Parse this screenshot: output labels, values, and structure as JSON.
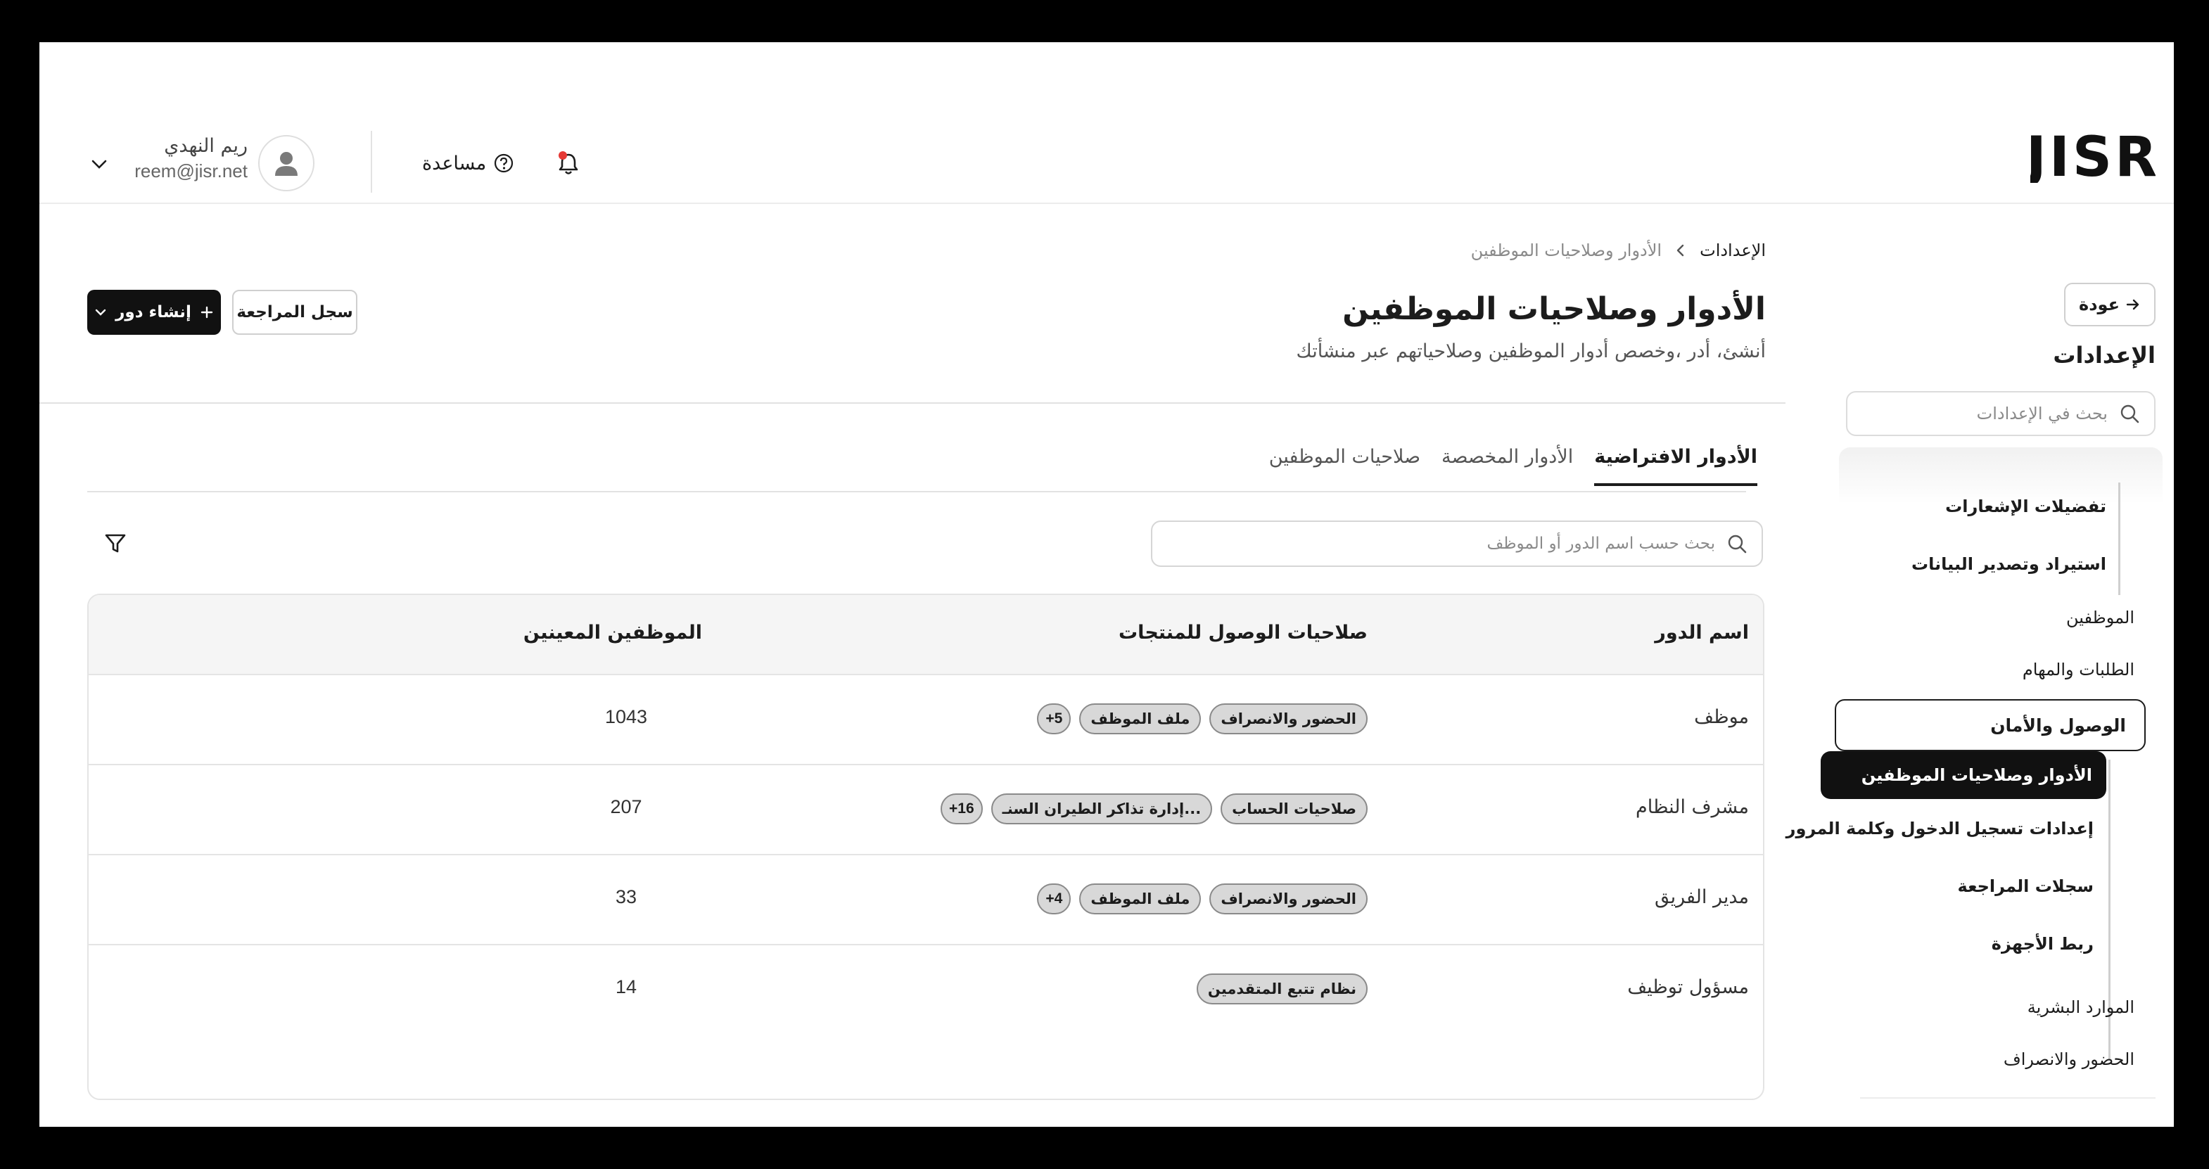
{
  "brand": {
    "logo_text": "JISR"
  },
  "header": {
    "help_label": "مساعدة",
    "user_name": "ريم النهدي",
    "user_email": "reem@jisr.net",
    "notification_dot_color": "#e53935"
  },
  "sidebar": {
    "back_label": "عودة",
    "title": "الإعدادات",
    "search_placeholder": "بحث في الإعدادات",
    "items": {
      "notif_prefs": "تفضيلات الإشعارات",
      "import_export": "استيراد وتصدير البيانات",
      "employees": "الموظفين",
      "requests_tasks": "الطلبات والمهام",
      "access_security": "الوصول والأمان",
      "roles_permissions": "الأدوار وصلاحيات الموظفين",
      "login_settings": "إعدادات تسجيل الدخول وكلمة المرور",
      "audit_logs": "سجلات المراجعة",
      "device_linking": "ربط الأجهزة",
      "hr": "الموارد البشرية",
      "attendance": "الحضور والانصراف"
    }
  },
  "breadcrumb": {
    "root": "الإعدادات",
    "current": "الأدوار وصلاحيات الموظفين"
  },
  "page": {
    "title": "الأدوار وصلاحيات الموظفين",
    "subtitle": "أنشئ، أدر ،وخصص أدوار الموظفين وصلاحياتهم عبر منشأتك",
    "create_label": "إنشاء دور",
    "audit_label": "سجل المراجعة"
  },
  "tabs": [
    "الأدوار الافتراضية",
    "الأدوار المخصصة",
    "صلاحيات الموظفين"
  ],
  "table": {
    "search_placeholder": "بحث حسب اسم الدور أو الموظف",
    "headers": {
      "role": "اسم الدور",
      "access": "صلاحيات الوصول للمنتجات",
      "assigned": "الموظفين المعينين"
    },
    "rows": [
      {
        "role": "موظف",
        "badges": [
          "الحضور والانصراف",
          "ملف الموظف"
        ],
        "more": "+5",
        "count": "1043"
      },
      {
        "role": "مشرف النظام",
        "badges": [
          "صلاحيات الحساب",
          "إدارة تذاكر الطيران السنـ..."
        ],
        "more": "+16",
        "count": "207"
      },
      {
        "role": "مدير الفريق",
        "badges": [
          "الحضور والانصراف",
          "ملف الموظف"
        ],
        "more": "+4",
        "count": "33"
      },
      {
        "role": "مسؤول توظيف",
        "badges": [
          "نظام تتبع المتقدمين"
        ],
        "more": "",
        "count": "14"
      }
    ]
  }
}
